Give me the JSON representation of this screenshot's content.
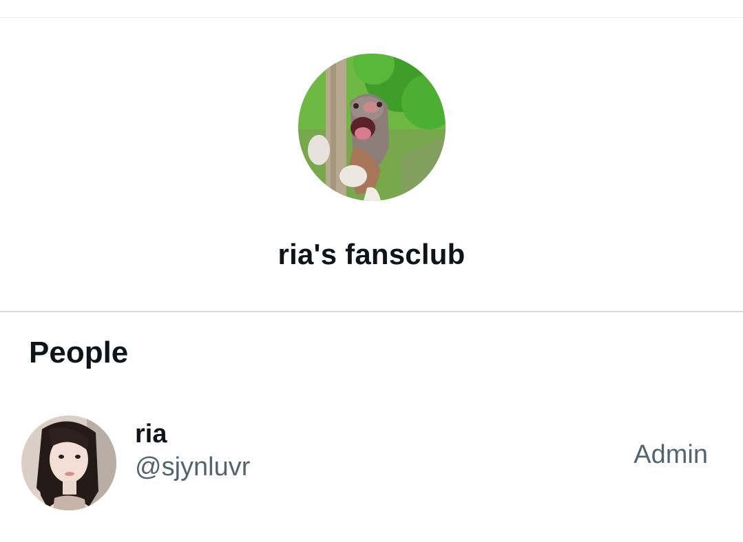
{
  "group": {
    "name": "ria's fansclub",
    "avatar_icon": "group-avatar-dog-photo"
  },
  "people_section": {
    "title": "People",
    "members": [
      {
        "name": "ria",
        "handle": "@sjynluvr",
        "role": "Admin",
        "avatar_icon": "member-avatar-photo"
      }
    ]
  },
  "colors": {
    "text_primary": "#0f1419",
    "text_secondary": "#536471",
    "divider": "#d5d9dc"
  }
}
